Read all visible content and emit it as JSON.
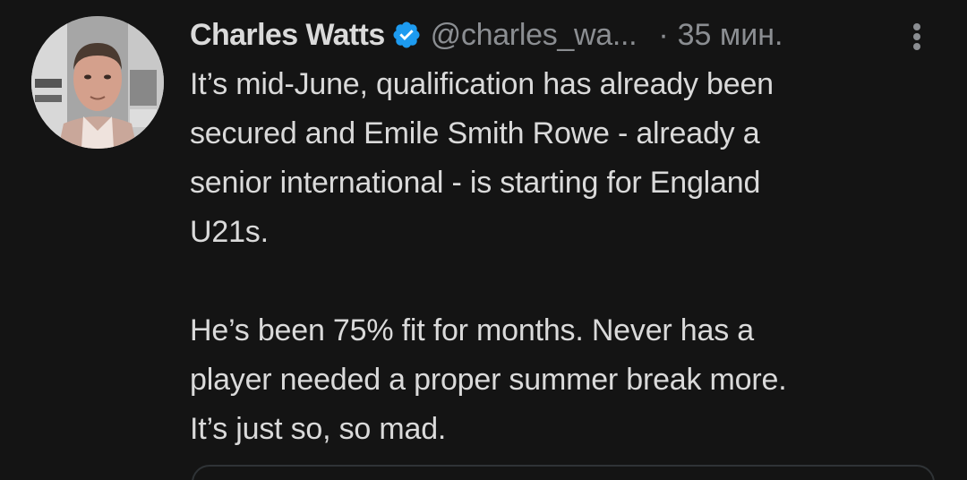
{
  "tweet": {
    "author_name": "Charles Watts",
    "handle": "@charles_wa...",
    "separator": "·",
    "time": "35 мин.",
    "lines": [
      "It’s mid-June, qualification has already been",
      "secured and Emile Smith Rowe - already a",
      "senior international - is starting for England",
      "U21s.",
      "He’s been 75% fit for months. Never has a",
      "player needed a proper summer break more.",
      "It’s just so, so mad."
    ]
  },
  "icons": {
    "verified": "verified-badge-icon",
    "more": "more-vertical-icon"
  },
  "colors": {
    "background": "#141414",
    "text": "#dadada",
    "muted": "#8b8e92",
    "verified": "#1d9bf0"
  }
}
